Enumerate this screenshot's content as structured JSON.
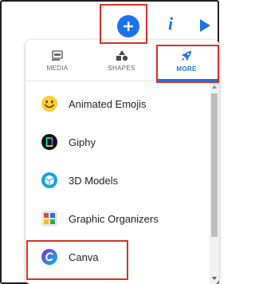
{
  "toolbar": {
    "add_icon": "plus-icon",
    "info_glyph": "i",
    "play_icon": "play-icon",
    "accent_color": "#1a73e8"
  },
  "tabs": [
    {
      "label": "MEDIA",
      "icon": "media-icon",
      "active": false
    },
    {
      "label": "SHAPES",
      "icon": "shapes-icon",
      "active": false
    },
    {
      "label": "MORE",
      "icon": "rocket-icon",
      "active": true
    }
  ],
  "items": [
    {
      "label": "Animated Emojis",
      "icon": "emoji-icon"
    },
    {
      "label": "Giphy",
      "icon": "giphy-icon"
    },
    {
      "label": "3D Models",
      "icon": "cube-icon"
    },
    {
      "label": "Graphic Organizers",
      "icon": "organizer-icon"
    },
    {
      "label": "Canva",
      "icon": "canva-icon"
    }
  ],
  "highlight_color": "#d93025"
}
